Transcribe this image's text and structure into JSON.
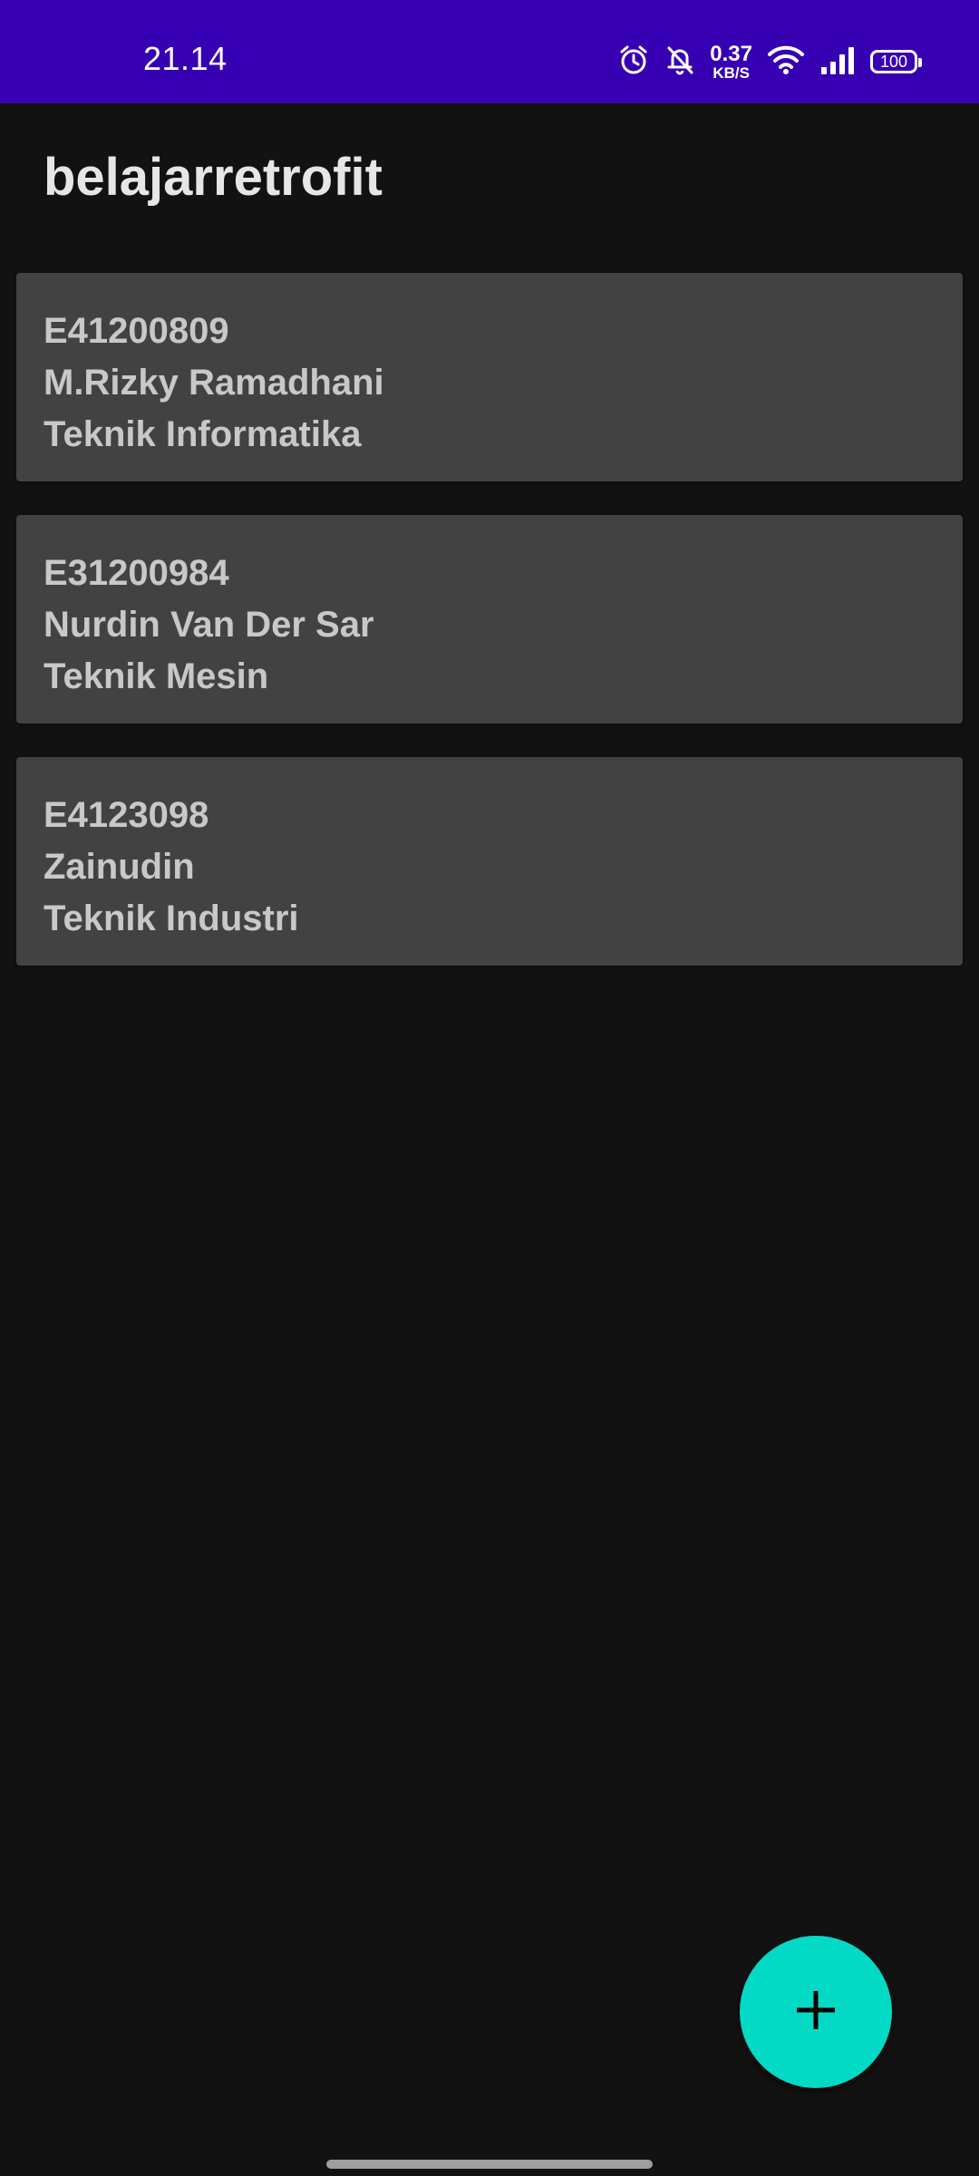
{
  "status_bar": {
    "time": "21.14",
    "net_speed_value": "0.37",
    "net_speed_unit": "KB/S",
    "battery_level": "100",
    "icons": [
      "alarm-icon",
      "bell-off-icon",
      "wifi-icon",
      "signal-icon",
      "battery-icon"
    ]
  },
  "app": {
    "title": "belajarretrofit"
  },
  "students": [
    {
      "nim": "E41200809",
      "name": "M.Rizky Ramadhani",
      "major": "Teknik Informatika"
    },
    {
      "nim": "E31200984",
      "name": "Nurdin Van Der Sar",
      "major": "Teknik Mesin"
    },
    {
      "nim": "E4123098",
      "name": "Zainudin",
      "major": "Teknik Industri"
    }
  ],
  "fab": {
    "icon": "plus-icon"
  },
  "colors": {
    "status_bar": "#3700B3",
    "background": "#121212",
    "card": "#424242",
    "fab": "#03DAC5"
  }
}
